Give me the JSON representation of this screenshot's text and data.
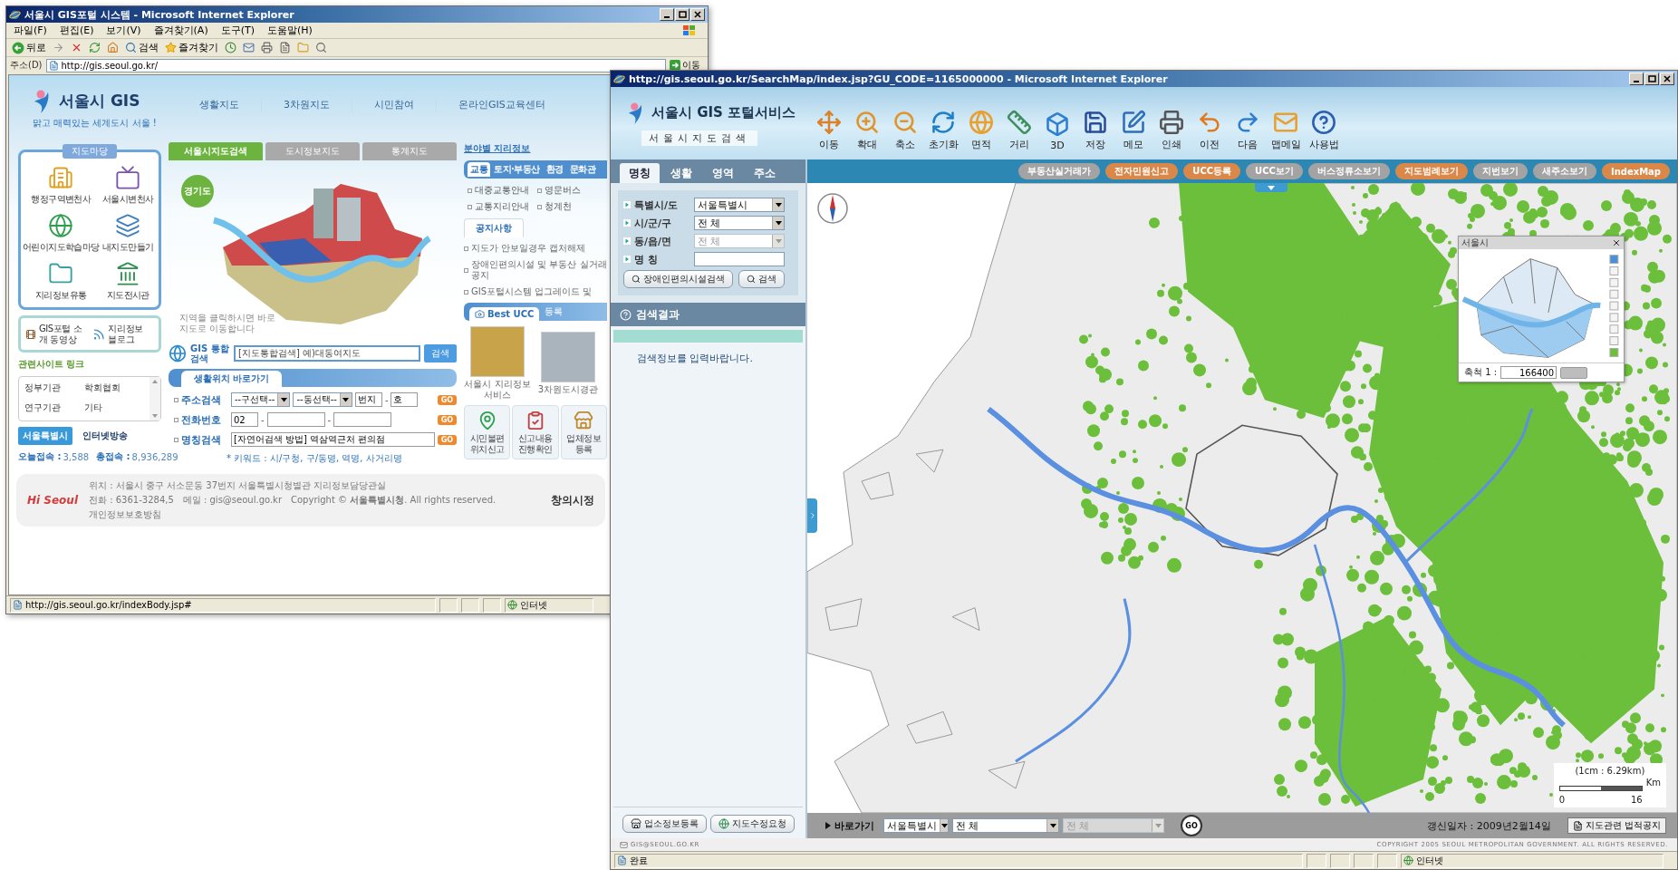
{
  "left_window": {
    "title": "서울시 GIS포털 시스템 - Microsoft Internet Explorer",
    "menu": [
      "파일(F)",
      "편집(E)",
      "보기(V)",
      "즐겨찾기(A)",
      "도구(T)",
      "도움말(H)"
    ],
    "toolbar": {
      "back": "뒤로",
      "search": "검색",
      "favorites": "즐겨찾기"
    },
    "address": {
      "label": "주소(D)",
      "url": "http://gis.seoul.go.kr/",
      "go": "이동"
    },
    "page": {
      "logo": "서울시 GIS",
      "slogan": "맑고 매력있는 세계도시 서울 !",
      "nav": [
        "생활지도",
        "3차원지도",
        "시민참여",
        "온라인GIS교육센터"
      ],
      "map_yard": {
        "title": "지도마당",
        "items": [
          "행정구역변천사",
          "서울시변천사",
          "어린이지도학습마당",
          "내지도만들기",
          "지리정보유통",
          "지도전시관"
        ]
      },
      "promo": [
        "GIS포털 소개 동영상",
        "지리정보 블로그"
      ],
      "related": {
        "title": "관련사이트 링크",
        "items": [
          "정부기관",
          "학회협회",
          "연구기관",
          "기타"
        ]
      },
      "banners": [
        "서울특별시",
        "인터넷방송"
      ],
      "counters": [
        {
          "label": "오늘접속 :",
          "value": "3,588"
        },
        {
          "label": "총접속 :",
          "value": "8,936,289"
        }
      ],
      "map_tabs": [
        {
          "label": "서울시지도검색",
          "selected": true
        },
        {
          "label": "도시정보지도",
          "selected": false
        },
        {
          "label": "통계지도",
          "selected": false
        }
      ],
      "region_badge": "경기도",
      "map_hint": "지역을 클릭하시면 바로 지도로 이동합니다",
      "search": {
        "label": "GIS 통합검색",
        "value": "[지도통합검색] 예)대동여지도",
        "button": "검색"
      },
      "quick": {
        "title": "생활위치 바로가기",
        "rows": [
          {
            "label": "주소검색",
            "fields": [
              {
                "kind": "select",
                "value": "--구선택--"
              },
              {
                "kind": "select",
                "value": "--동선택--"
              },
              {
                "kind": "input",
                "value": "번지"
              },
              {
                "kind": "dash",
                "value": "-"
              },
              {
                "kind": "input",
                "value": "호"
              }
            ],
            "button": "GO"
          },
          {
            "label": "전화번호",
            "fields": [
              {
                "kind": "input",
                "value": "02"
              },
              {
                "kind": "dash",
                "value": "-"
              },
              {
                "kind": "input"
              },
              {
                "kind": "dash",
                "value": "-"
              },
              {
                "kind": "input"
              }
            ],
            "button": "GO"
          },
          {
            "label": "명칭검색",
            "fields": [
              {
                "kind": "wide",
                "value": "[자연어검색 방법] 역삼역근처 편의점"
              }
            ],
            "button": "GO"
          }
        ],
        "keywords": "* 키워드 : 시/구청, 구/동명, 역명, 사거리명"
      },
      "field_info": {
        "title": "분야별 지리정보",
        "tabs": [
          {
            "label": "교통",
            "selected": true
          },
          {
            "label": "토지·부동산",
            "selected": false
          },
          {
            "label": "환경",
            "selected": false
          },
          {
            "label": "문화관",
            "selected": false
          }
        ],
        "links": [
          "대중교통안내",
          "영문버스",
          "교통지리안내",
          "청계천"
        ]
      },
      "notice": {
        "title": "공지사항",
        "items": [
          "지도가 안보일경우 캡처해제",
          "장애인편의시설 및 부동산 실거래 공지",
          "GIS포털시스템 업그레이드 및"
        ]
      },
      "ucc": {
        "title": "Best UCC",
        "register": "등록",
        "items": [
          "서울시 지리정보서비스",
          "3차원도시경관"
        ]
      },
      "services": [
        "시민불편 위치신고",
        "신고내용 진행확인",
        "업체정보 등록"
      ],
      "footer": {
        "logo": "Hi Seoul",
        "address": "위치 : 서울시 중구 서소문동 37번지 서울특별시청별관 지리정보담당관실",
        "contact": [
          "전화 : 6361-3284,5",
          "메일 : gis@seoul.go.kr",
          "Copyright © **서울특별시청**. All rights reserved.",
          "개인정보보호방침"
        ],
        "brand": "창의시정"
      }
    },
    "status": {
      "url": "http://gis.seoul.go.kr/indexBody.jsp#",
      "zone": "인터넷"
    }
  },
  "right_window": {
    "title": "http://gis.seoul.go.kr/SearchMap/index.jsp?GU_CODE=1165000000 - Microsoft Internet Explorer",
    "logo": "서울시 GIS 포털서비스",
    "subtitle": "서울시지도검색",
    "tools": [
      "이동",
      "확대",
      "축소",
      "초기화",
      "면적",
      "거리",
      "3D",
      "저장",
      "메모",
      "인쇄",
      "이전",
      "다음",
      "맵메일",
      "사용법"
    ],
    "side_tabs": [
      {
        "label": "명칭",
        "selected": true
      },
      {
        "label": "생활",
        "selected": false
      },
      {
        "label": "영역",
        "selected": false
      },
      {
        "label": "주소",
        "selected": false
      }
    ],
    "form": [
      {
        "label": "특별시/도",
        "kind": "select",
        "value": "서울특별시",
        "disabled": false
      },
      {
        "label": "시/군/구",
        "kind": "select",
        "value": "전 체",
        "disabled": false
      },
      {
        "label": "동/읍/면",
        "kind": "select",
        "value": "전 체",
        "disabled": true
      },
      {
        "label": "명 칭",
        "kind": "input"
      }
    ],
    "form_buttons": [
      "장애인편의시설검색",
      "검색"
    ],
    "results": {
      "title": "검색결과",
      "message": "검색정보를 입력바랍니다."
    },
    "panel_buttons": [
      "업소정보등록",
      "지도수정요청"
    ],
    "email": "GIS@SEOUL.GO.KR",
    "top_buttons": [
      {
        "label": "부동산실거래가",
        "color": "#a3a3a3"
      },
      {
        "label": "전자민원신고",
        "color": "#d9884a"
      },
      {
        "label": "UCC등록",
        "color": "#d9884a"
      },
      {
        "label": "UCC보기",
        "color": "#a3a3a3"
      },
      {
        "label": "버스정류소보기",
        "color": "#a3a3a3"
      },
      {
        "label": "지도범례보기",
        "color": "#d9884a"
      },
      {
        "label": "지번보기",
        "color": "#a3a3a3"
      },
      {
        "label": "새주소보기",
        "color": "#a3a3a3"
      },
      {
        "label": "IndexMap",
        "color": "#d9884a"
      }
    ],
    "overview": {
      "title": "서울시",
      "scale_label": "축척 1 :",
      "scale_value": "166400"
    },
    "scale_bar": {
      "ratio": "(1cm : 6.29km)",
      "ticks": [
        "0",
        "16"
      ],
      "unit": "Km"
    },
    "goto": {
      "label": "바로가기",
      "selects": [
        {
          "value": "서울특별시",
          "disabled": false
        },
        {
          "value": "전 체",
          "disabled": false
        },
        {
          "value": "전 체",
          "disabled": true
        }
      ],
      "button": "GO"
    },
    "updated": "갱신일자 : 2009년2월14일",
    "legal": "지도관련 법적공지",
    "copyright": "COPYRIGHT 2005 SEOUL METROPOLITAN GOVERNMENT. ALL RIGHTS RESERVED.",
    "status": {
      "text": "완료",
      "zone": "인터넷"
    }
  }
}
